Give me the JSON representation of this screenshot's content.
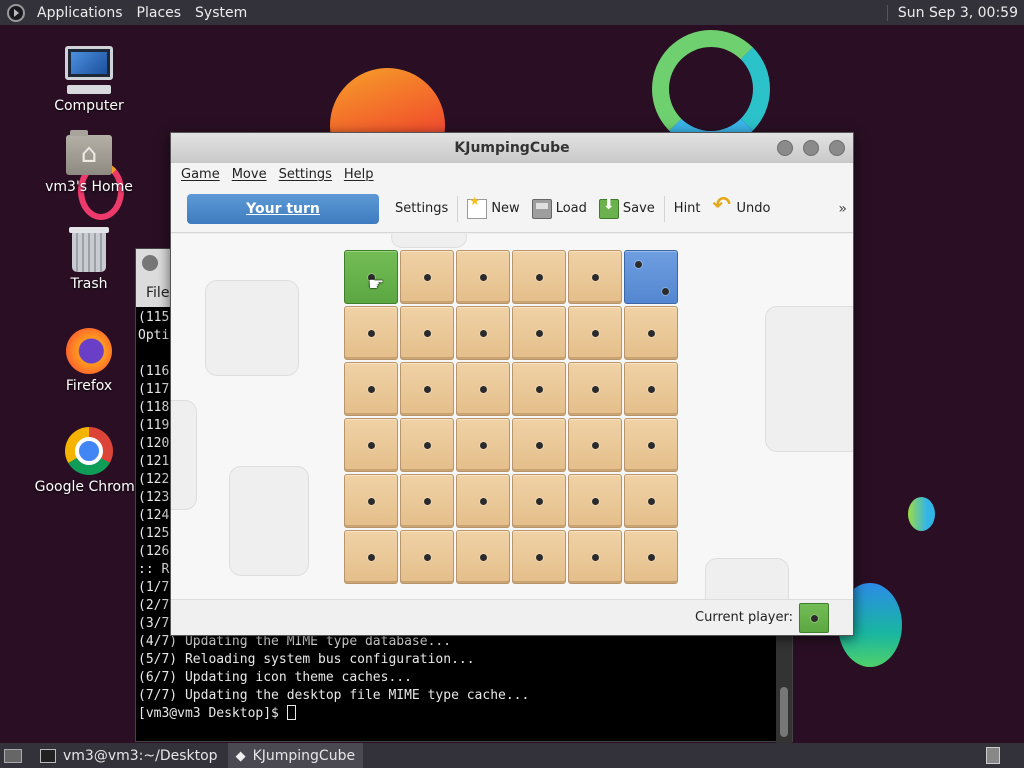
{
  "top_panel": {
    "menus": [
      "Applications",
      "Places",
      "System"
    ],
    "clock": "Sun Sep  3, 00:59"
  },
  "desktop_icons": [
    {
      "label": "Computer",
      "icon": "computer-icon"
    },
    {
      "label": "vm3's Home",
      "icon": "home-folder-icon"
    },
    {
      "label": "Trash",
      "icon": "trash-icon"
    },
    {
      "label": "Firefox",
      "icon": "firefox-icon"
    },
    {
      "label": "Google Chrome",
      "icon": "chrome-icon"
    }
  ],
  "terminal": {
    "menu_first": "File",
    "lines": [
      "(115",
      "Opti",
      "",
      "(116",
      "(117",
      "(118",
      "(119",
      "(120",
      "(121",
      "(122",
      "(123",
      "(124",
      "(125",
      "(126",
      ":: R",
      "(1/7",
      "(2/7",
      "(3/7) Arming ConditionNeedsUpdate...",
      "(4/7) Updating the MIME type database...",
      "(5/7) Reloading system bus configuration...",
      "(6/7) Updating icon theme caches...",
      "(7/7) Updating the desktop file MIME type cache..."
    ],
    "prompt": "[vm3@vm3 Desktop]$ "
  },
  "kjc": {
    "title": "KJumpingCube",
    "menus": [
      "Game",
      "Move",
      "Settings",
      "Help"
    ],
    "toolbar": {
      "turn_label": "Your turn",
      "settings": "Settings",
      "new": "New",
      "load": "Load",
      "save": "Save",
      "hint": "Hint",
      "undo": "Undo",
      "overflow": "»"
    },
    "board": {
      "size": 6,
      "colors": {
        "neutral": "#e9c596",
        "player1": "#66b14b",
        "player2": "#5d8fd6"
      },
      "cells": [
        [
          {
            "o": "green",
            "n": 1
          },
          {
            "o": "neutral",
            "n": 1
          },
          {
            "o": "neutral",
            "n": 1
          },
          {
            "o": "neutral",
            "n": 1
          },
          {
            "o": "neutral",
            "n": 1
          },
          {
            "o": "blue",
            "n": 2
          }
        ],
        [
          {
            "o": "neutral",
            "n": 1
          },
          {
            "o": "neutral",
            "n": 1
          },
          {
            "o": "neutral",
            "n": 1
          },
          {
            "o": "neutral",
            "n": 1
          },
          {
            "o": "neutral",
            "n": 1
          },
          {
            "o": "neutral",
            "n": 1
          }
        ],
        [
          {
            "o": "neutral",
            "n": 1
          },
          {
            "o": "neutral",
            "n": 1
          },
          {
            "o": "neutral",
            "n": 1
          },
          {
            "o": "neutral",
            "n": 1
          },
          {
            "o": "neutral",
            "n": 1
          },
          {
            "o": "neutral",
            "n": 1
          }
        ],
        [
          {
            "o": "neutral",
            "n": 1
          },
          {
            "o": "neutral",
            "n": 1
          },
          {
            "o": "neutral",
            "n": 1
          },
          {
            "o": "neutral",
            "n": 1
          },
          {
            "o": "neutral",
            "n": 1
          },
          {
            "o": "neutral",
            "n": 1
          }
        ],
        [
          {
            "o": "neutral",
            "n": 1
          },
          {
            "o": "neutral",
            "n": 1
          },
          {
            "o": "neutral",
            "n": 1
          },
          {
            "o": "neutral",
            "n": 1
          },
          {
            "o": "neutral",
            "n": 1
          },
          {
            "o": "neutral",
            "n": 1
          }
        ],
        [
          {
            "o": "neutral",
            "n": 1
          },
          {
            "o": "neutral",
            "n": 1
          },
          {
            "o": "neutral",
            "n": 1
          },
          {
            "o": "neutral",
            "n": 1
          },
          {
            "o": "neutral",
            "n": 1
          },
          {
            "o": "neutral",
            "n": 1
          }
        ]
      ]
    },
    "status": {
      "current_player_label": "Current player:",
      "current_player_color": "green"
    }
  },
  "taskbar": {
    "tasks": [
      {
        "label": "vm3@vm3:~/Desktop",
        "icon": "terminal-icon",
        "active": false
      },
      {
        "label": "KJumpingCube",
        "icon": "kjumpingcube-icon",
        "active": true
      }
    ]
  }
}
